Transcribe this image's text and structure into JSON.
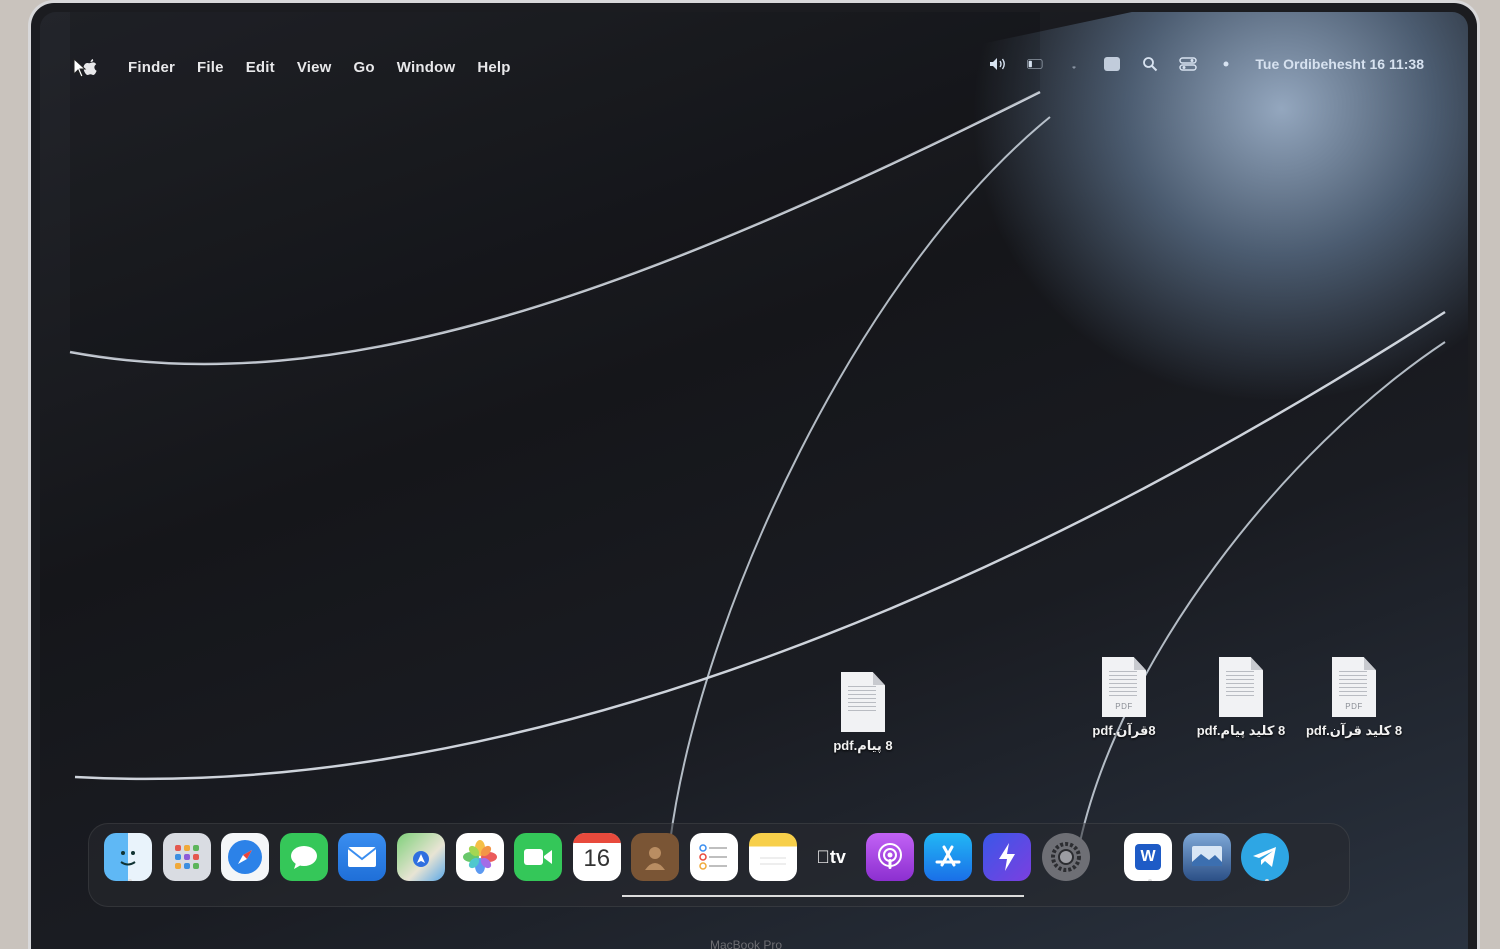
{
  "menubar": {
    "app_name": "Finder",
    "menus": [
      "File",
      "Edit",
      "View",
      "Go",
      "Window",
      "Help"
    ],
    "datetime": "Tue Ordibehesht 16  11:38"
  },
  "desktop_files": [
    {
      "name": "8 پیام.pdf",
      "kind": "pdf"
    },
    {
      "name": "8قرآن.pdf",
      "kind": "pdf",
      "tag": "PDF"
    },
    {
      "name": "8 کلید پیام.pdf",
      "kind": "pdf"
    },
    {
      "name": "8 کلید قرآن.pdf",
      "kind": "pdf",
      "tag": "PDF"
    }
  ],
  "dock": {
    "apps": [
      {
        "name": "Finder",
        "icon": "finder-icon"
      },
      {
        "name": "Launchpad",
        "icon": "launchpad-icon"
      },
      {
        "name": "Safari",
        "icon": "safari-icon"
      },
      {
        "name": "Messages",
        "icon": "messages-icon"
      },
      {
        "name": "Mail",
        "icon": "mail-icon"
      },
      {
        "name": "Maps",
        "icon": "maps-icon"
      },
      {
        "name": "Photos",
        "icon": "photos-icon"
      },
      {
        "name": "FaceTime",
        "icon": "facetime-icon"
      },
      {
        "name": "Calendar",
        "icon": "calendar-icon",
        "badge_text": "16"
      },
      {
        "name": "Contacts",
        "icon": "contacts-icon"
      },
      {
        "name": "Reminders",
        "icon": "reminders-icon"
      },
      {
        "name": "Notes",
        "icon": "notes-icon"
      },
      {
        "name": "TV",
        "icon": "appletv-icon",
        "badge_text": "tv"
      },
      {
        "name": "Podcasts",
        "icon": "podcasts-icon"
      },
      {
        "name": "App Store",
        "icon": "appstore-icon"
      },
      {
        "name": "Shortcuts",
        "icon": "shortcuts-icon"
      },
      {
        "name": "System Settings",
        "icon": "settings-icon"
      },
      {
        "name": "Microsoft Word",
        "icon": "word-icon",
        "badge_text": "W"
      },
      {
        "name": "Preview",
        "icon": "preview-icon"
      },
      {
        "name": "Telegram",
        "icon": "telegram-icon"
      }
    ]
  },
  "colors": {
    "menu_text": "#e8e8ea",
    "desktop_bg": "#17181c",
    "dock_bg": "#2a2c32"
  },
  "hardware": {
    "brand": "MacBook Pro"
  }
}
